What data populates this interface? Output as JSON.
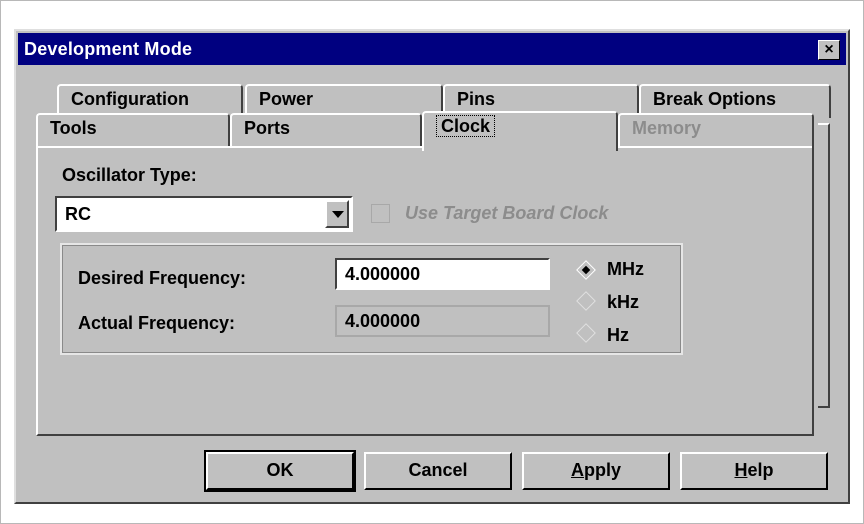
{
  "window": {
    "title": "Development Mode",
    "close_glyph": "×"
  },
  "tabs": {
    "row_back": [
      "Configuration",
      "Power",
      "Pins",
      "Break Options"
    ],
    "row_front": [
      "Tools",
      "Ports",
      "Clock",
      "Memory"
    ],
    "active": "Clock",
    "disabled": [
      "Memory"
    ]
  },
  "clock": {
    "oscillator_label": "Oscillator Type:",
    "oscillator_value": "RC",
    "use_target_label": "Use Target Board Clock",
    "desired_label": "Desired Frequency:",
    "desired_value": "4.000000",
    "actual_label": "Actual Frequency:",
    "actual_value": "4.000000",
    "units": [
      "MHz",
      "kHz",
      "Hz"
    ],
    "selected_unit": "MHz"
  },
  "buttons": {
    "ok": "OK",
    "cancel": "Cancel",
    "apply_a": "A",
    "apply_rest": "pply",
    "help_h": "H",
    "help_rest": "elp"
  },
  "icons": {
    "close": "close-icon",
    "dropdown": "chevron-down-icon"
  }
}
